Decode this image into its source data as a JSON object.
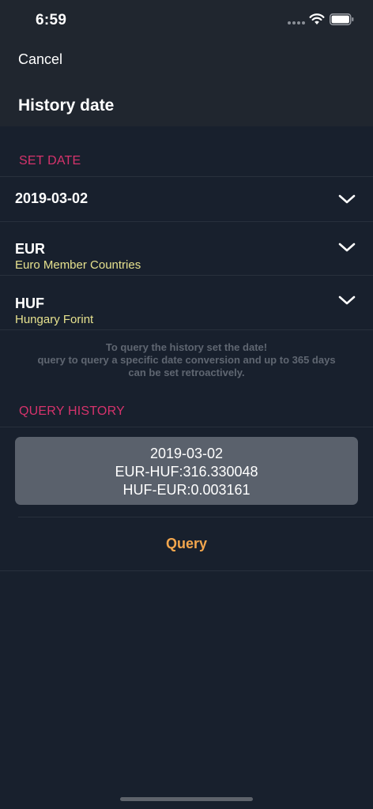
{
  "status_bar": {
    "time": "6:59"
  },
  "nav": {
    "cancel_label": "Cancel",
    "title": "History date"
  },
  "set_date": {
    "header": "SET DATE",
    "date_value": "2019-03-02",
    "from_currency": {
      "code": "EUR",
      "name": "Euro Member Countries"
    },
    "to_currency": {
      "code": "HUF",
      "name": "Hungary Forint"
    }
  },
  "info": {
    "line1": "To query the history set the date!",
    "line2": "query to query a specific date conversion and up to 365 days",
    "line3": "can be set retroactively."
  },
  "query_history": {
    "header": "QUERY HISTORY",
    "result": {
      "date": "2019-03-02",
      "forward_rate": "EUR-HUF:316.330048",
      "reverse_rate": "HUF-EUR:0.003161"
    }
  },
  "query_button": {
    "label": "Query"
  },
  "colors": {
    "background": "#18202d",
    "header_background": "#20262f",
    "section_accent": "#d6336c",
    "currency_name": "#e6e18e",
    "query_button": "#f3a64d",
    "result_card": "#5a616c"
  }
}
